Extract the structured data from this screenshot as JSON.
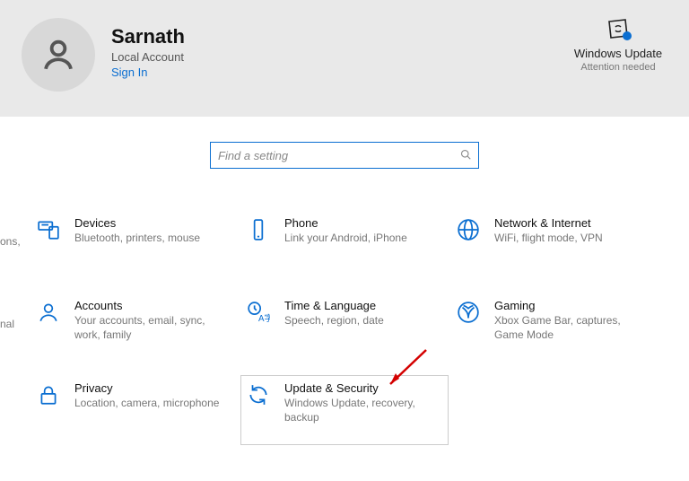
{
  "user": {
    "name": "Sarnath",
    "account_type": "Local Account",
    "signin_label": "Sign In"
  },
  "windows_update": {
    "title": "Windows Update",
    "sub": "Attention needed"
  },
  "search": {
    "placeholder": "Find a setting"
  },
  "edge_items": {
    "a": "ons,",
    "b": "nal"
  },
  "categories": {
    "devices": {
      "title": "Devices",
      "sub": "Bluetooth, printers, mouse"
    },
    "phone": {
      "title": "Phone",
      "sub": "Link your Android, iPhone"
    },
    "network": {
      "title": "Network & Internet",
      "sub": "WiFi, flight mode, VPN"
    },
    "accounts": {
      "title": "Accounts",
      "sub": "Your accounts, email, sync, work, family"
    },
    "time": {
      "title": "Time & Language",
      "sub": "Speech, region, date"
    },
    "gaming": {
      "title": "Gaming",
      "sub": "Xbox Game Bar, captures, Game Mode"
    },
    "privacy": {
      "title": "Privacy",
      "sub": "Location, camera, microphone"
    },
    "update": {
      "title": "Update & Security",
      "sub": "Windows Update, recovery, backup"
    }
  }
}
